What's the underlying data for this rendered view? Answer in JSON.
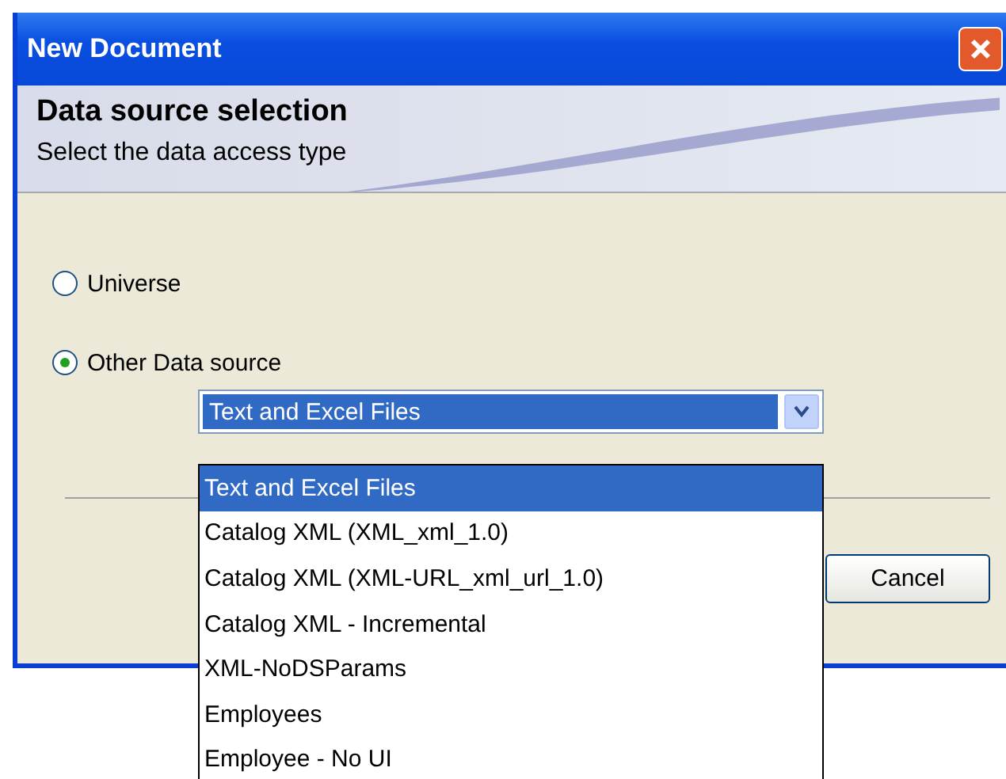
{
  "window": {
    "title": "New Document"
  },
  "header": {
    "title": "Data source selection",
    "subtitle": "Select the data access type"
  },
  "options": [
    {
      "label": "Universe",
      "selected": false
    },
    {
      "label": "Other Data source",
      "selected": true
    }
  ],
  "data_source": {
    "value": "Text and Excel Files",
    "expanded": true,
    "items": [
      {
        "label": "Text and Excel Files",
        "selected": true
      },
      {
        "label": "Catalog XML (XML_xml_1.0)",
        "selected": false
      },
      {
        "label": "Catalog XML (XML-URL_xml_url_1.0)",
        "selected": false
      },
      {
        "label": "Catalog XML - Incremental",
        "selected": false
      },
      {
        "label": "XML-NoDSParams",
        "selected": false
      },
      {
        "label": "Employees",
        "selected": false
      },
      {
        "label": "Employee - No UI",
        "selected": false
      }
    ]
  },
  "buttons": [
    {
      "label": "Cancel"
    }
  ]
}
